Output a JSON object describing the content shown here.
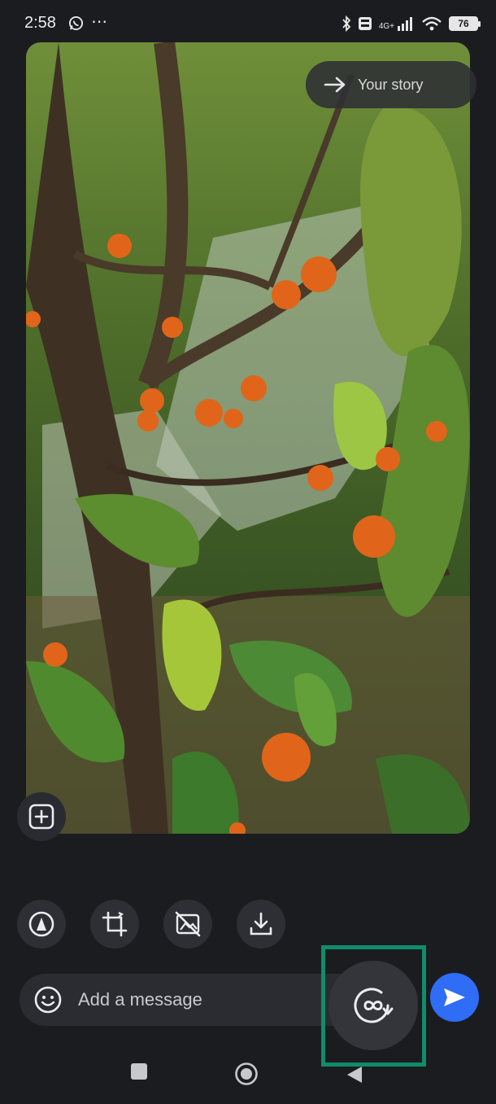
{
  "status_bar": {
    "time": "2:58",
    "dots": "⋯",
    "network_label_top": "4G+",
    "battery": "76",
    "icons": [
      "whatsapp-icon",
      "bluetooth-icon",
      "volte-icon",
      "signal-icon",
      "wifi-icon",
      "battery-icon"
    ]
  },
  "share": {
    "label": "Your story",
    "icon": "arrow-right-icon"
  },
  "tools": [
    {
      "name": "markup-icon"
    },
    {
      "name": "crop-rotate-icon"
    },
    {
      "name": "hide-photo-icon"
    },
    {
      "name": "download-icon"
    }
  ],
  "composer": {
    "placeholder": "Add a message",
    "emoji_icon": "emoji-icon",
    "loop_icon": "view-once-loop-icon",
    "send_icon": "send-icon",
    "add_icon": "add-icon"
  },
  "colors": {
    "background": "#1b1c20",
    "send": "#2f6df6",
    "highlight": "#0f8c6a"
  },
  "nav": [
    "recents-icon",
    "home-icon",
    "back-icon"
  ]
}
